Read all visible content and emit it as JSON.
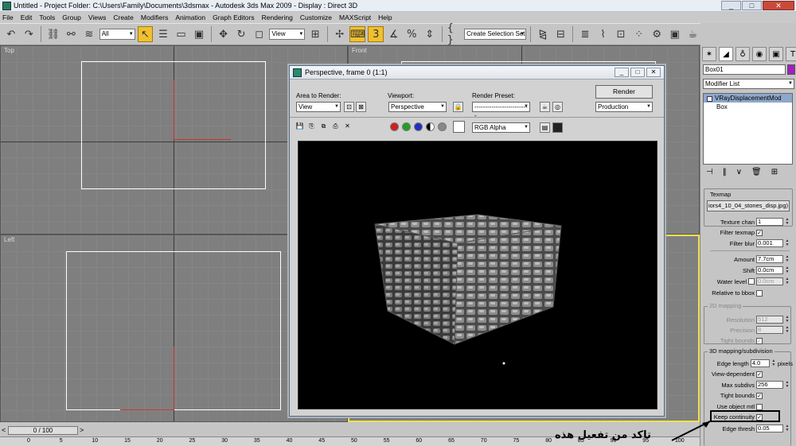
{
  "window": {
    "title": "Untitled     - Project Folder: C:\\Users\\Family\\Documents\\3dsmax     - Autodesk 3ds Max  2009      - Display : Direct 3D",
    "min": "_",
    "max": "□",
    "close": "✕"
  },
  "menu": [
    "File",
    "Edit",
    "Tools",
    "Group",
    "Views",
    "Create",
    "Modifiers",
    "Animation",
    "Graph Editors",
    "Rendering",
    "Customize",
    "MAXScript",
    "Help"
  ],
  "toolbar": {
    "selection_filter": "All",
    "ref_coord": "View",
    "named_selection": "Create Selection Set"
  },
  "viewports": {
    "top": "Top",
    "front": "Front",
    "left": "Left"
  },
  "right_panel": {
    "object_name": "Box01",
    "modifier_list": "Modifier List",
    "stack": [
      "VRayDisplacementMod",
      "Box"
    ],
    "texmap_label": "Texmap",
    "texmap_file": "iors4_10_04_stones_disp.jpg)",
    "texture_chan_label": "Texture chan",
    "texture_chan": "1",
    "filter_texmap_label": "Filter texmap",
    "filter_blur_label": "Filter blur",
    "filter_blur": "0.001",
    "amount_label": "Amount",
    "amount": "7.7cm",
    "shift_label": "Shift",
    "shift": "0.0cm",
    "water_level_label": "Water level",
    "water_level": "0.0cm",
    "relative_bbox_label": "Relative to bbox",
    "mapping2d_title": "2D mapping",
    "resolution_label": "Resolution",
    "resolution": "512",
    "precision_label": "Precision",
    "precision": "8",
    "tight_bounds_label": "Tight bounds",
    "mapping3d_title": "3D mapping/subdivision",
    "edge_length_label": "Edge length",
    "edge_length": "4.0",
    "pixels_label": "pixels",
    "view_dependent_label": "View-dependent",
    "max_subdivs_label": "Max subdivs",
    "max_subdivs": "256",
    "tight_bounds2_label": "Tight bounds",
    "use_object_mtl_label": "Use object mtl",
    "keep_continuity_label": "Keep continuity",
    "edge_thresh_label": "Edge thresh",
    "edge_thresh": "0.05",
    "check": "✓"
  },
  "render_window": {
    "title": "Perspective, frame 0 (1:1)",
    "area_label": "Area to Render:",
    "area_value": "View",
    "viewport_label": "Viewport:",
    "viewport_value": "Perspective",
    "preset_label": "Render Preset:",
    "preset_value": "--------------------------",
    "render_button": "Render",
    "mode_value": "Production",
    "channel_value": "RGB Alpha",
    "min": "_",
    "max": "□",
    "close": "✕"
  },
  "time": {
    "slider": "0 / 100",
    "ticks": [
      "0",
      "5",
      "10",
      "15",
      "20",
      "25",
      "30",
      "35",
      "40",
      "45",
      "50",
      "55",
      "60",
      "65",
      "70",
      "75",
      "80",
      "85",
      "90",
      "95",
      "100"
    ]
  },
  "annotation": {
    "arabic": "تاكد من تفعيل هذه"
  },
  "colors": {
    "accent_yellow": "#f0c030",
    "viewport_bg": "#7f7f7f",
    "selection_blue": "#8ea8cc"
  }
}
